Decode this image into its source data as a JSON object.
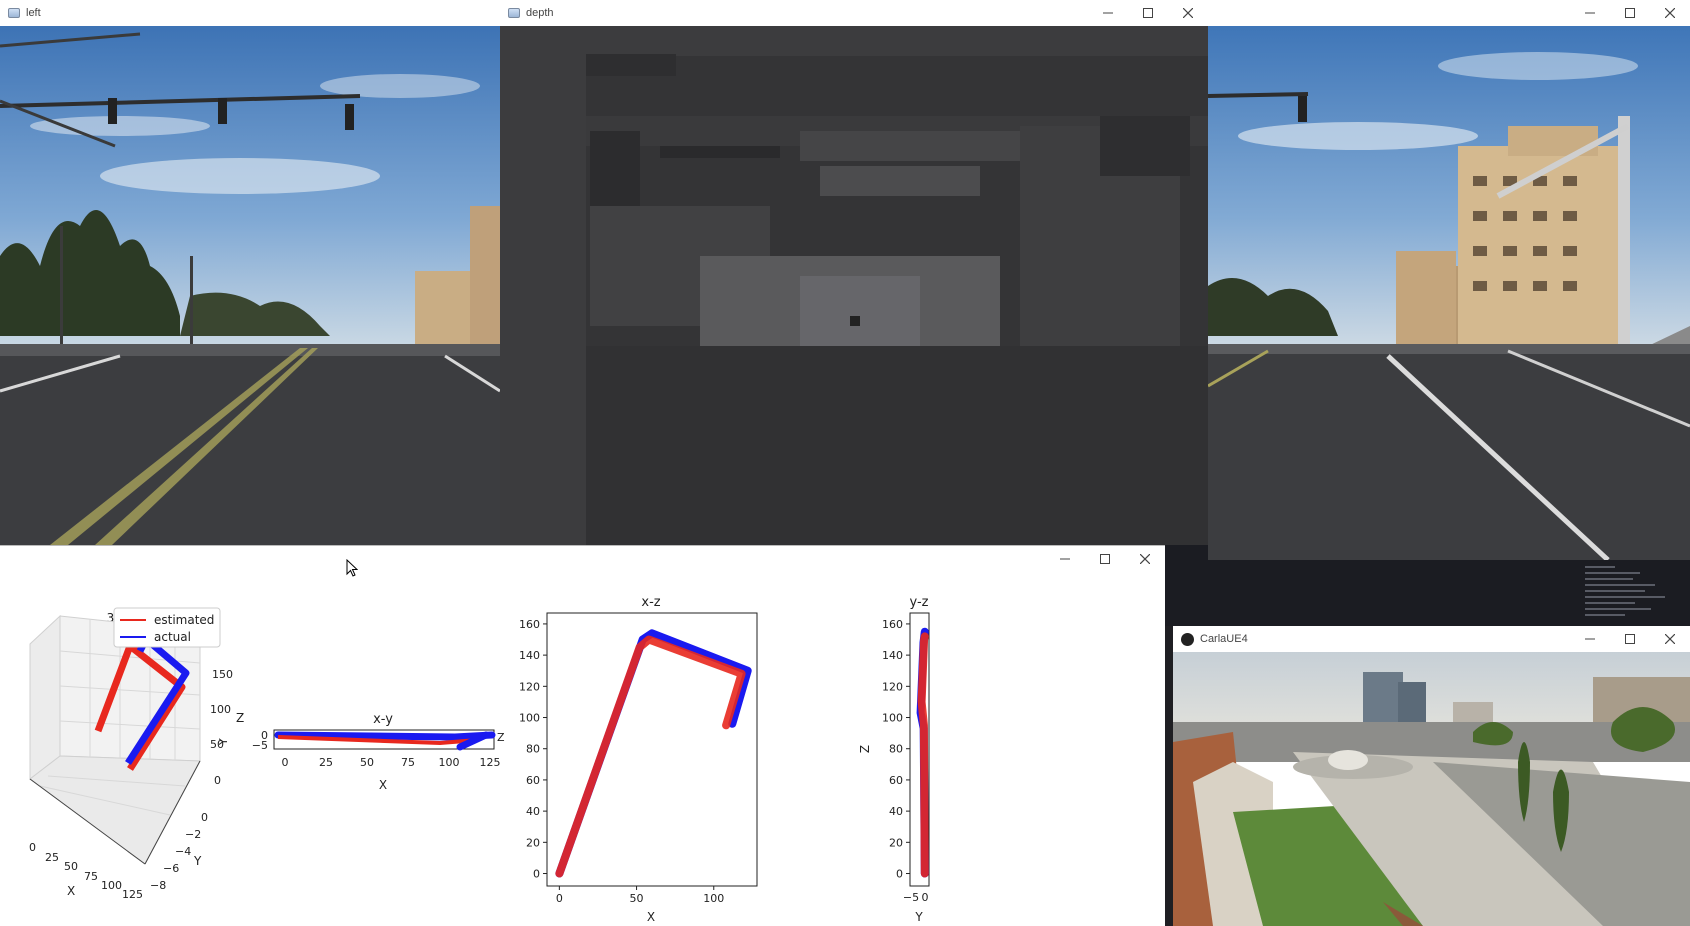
{
  "windows": {
    "left": {
      "title": "left"
    },
    "depth": {
      "title": "depth"
    },
    "right": {
      "title": ""
    },
    "plot": {
      "title": ""
    },
    "carla": {
      "title": "CarlaUE4"
    }
  },
  "window_controls": {
    "minimize": "—",
    "maximize": "☐",
    "close": "✕"
  },
  "plots": {
    "plot_3d": {
      "title": "3D",
      "legend": [
        "estimated",
        "actual"
      ],
      "z_ticks": [
        "150",
        "100",
        "50",
        "0"
      ],
      "z_label": "Z",
      "y_ticks": [
        "0",
        "−2",
        "−4",
        "−6",
        "−8"
      ],
      "y_label": "Y",
      "x_ticks": [
        "0",
        "25",
        "50",
        "75",
        "100",
        "125"
      ],
      "x_label": "X"
    },
    "plot_xy": {
      "title": "x-y",
      "x_ticks": [
        "0",
        "25",
        "50",
        "75",
        "100",
        "125"
      ],
      "y_ticks": [
        "0",
        "−5"
      ],
      "x_label": "X",
      "y_label": "Y",
      "z_label": "Z"
    },
    "plot_xz": {
      "title": "x-z",
      "x_ticks": [
        "0",
        "50",
        "100"
      ],
      "y_ticks": [
        "160",
        "140",
        "120",
        "100",
        "80",
        "60",
        "40",
        "20",
        "0"
      ],
      "x_label": "X"
    },
    "plot_yz": {
      "title": "y-z",
      "y_ticks": [
        "160",
        "140",
        "120",
        "100",
        "80",
        "60",
        "40",
        "20",
        "0"
      ],
      "x_ticks": [
        "−5",
        "0"
      ],
      "x_label": "Y",
      "y_label": "Z"
    }
  },
  "colors": {
    "estimated": "#e8281e",
    "actual": "#1a1af0"
  },
  "chart_data": [
    {
      "type": "line",
      "title": "x-z",
      "xlabel": "X",
      "ylabel": "",
      "xlim": [
        -8,
        128
      ],
      "ylim": [
        -8,
        167
      ],
      "series": [
        {
          "name": "estimated",
          "x": [
            0,
            52,
            58,
            118,
            108
          ],
          "y": [
            0,
            145,
            150,
            128,
            95
          ]
        },
        {
          "name": "actual",
          "x": [
            0,
            54,
            60,
            122,
            112
          ],
          "y": [
            0,
            150,
            154,
            130,
            96
          ]
        }
      ]
    },
    {
      "type": "line",
      "title": "y-z",
      "xlabel": "Y",
      "ylabel": "Z",
      "xlim": [
        -7,
        2
      ],
      "ylim": [
        -8,
        167
      ],
      "series": [
        {
          "name": "estimated",
          "x": [
            0,
            -0.4,
            -1.5,
            -0.3,
            0
          ],
          "y": [
            0,
            95,
            110,
            150,
            152
          ]
        },
        {
          "name": "actual",
          "x": [
            0,
            -0.5,
            -2,
            -0.6,
            0
          ],
          "y": [
            0,
            93,
            103,
            148,
            155
          ]
        }
      ]
    },
    {
      "type": "line",
      "title": "x-y",
      "xlabel": "X",
      "ylabel": "Y",
      "xlim": [
        -8,
        128
      ],
      "ylim": [
        -7,
        1
      ],
      "series": [
        {
          "name": "estimated",
          "x": [
            0,
            60,
            110,
            118
          ],
          "y": [
            0,
            0,
            -1,
            -5
          ]
        },
        {
          "name": "actual",
          "x": [
            0,
            60,
            112,
            122
          ],
          "y": [
            0,
            0,
            -0.5,
            -5
          ]
        }
      ]
    }
  ]
}
